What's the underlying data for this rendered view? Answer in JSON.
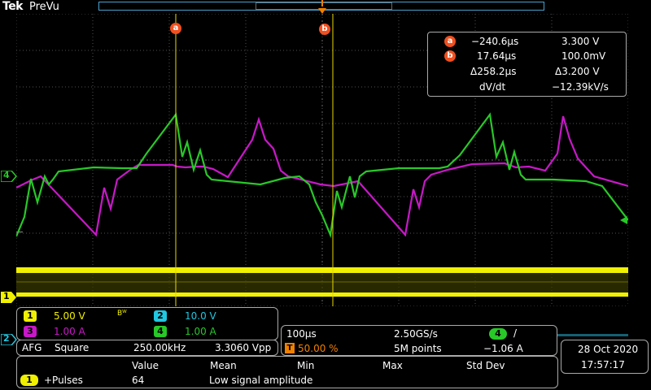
{
  "header": {
    "brand": "Tek",
    "mode": "PreVu"
  },
  "cursors": {
    "a": {
      "marker": "a",
      "time": "−240.6µs",
      "value": "3.300 V"
    },
    "b": {
      "marker": "b",
      "time": "17.64µs",
      "value": "100.0mV"
    },
    "delta": {
      "time": "Δ258.2µs",
      "value": "Δ3.200 V"
    },
    "slope": {
      "label": "dV/dt",
      "value": "−12.39kV/s"
    }
  },
  "channels": {
    "ch1": {
      "number": "1",
      "scale": "5.00 V",
      "bw": "Bᵂ",
      "color": "#f0f000"
    },
    "ch2": {
      "number": "2",
      "scale": "10.0 V",
      "color": "#20c8e0"
    },
    "ch3": {
      "number": "3",
      "scale": "1.00 A",
      "color": "#c818c8"
    },
    "ch4": {
      "number": "4",
      "scale": "1.00 A",
      "color": "#28c828"
    }
  },
  "waveforms": {
    "ch4_marker": "4",
    "ch1_marker": "1",
    "ch2_marker": "2"
  },
  "acquisition": {
    "timebase": "100µs",
    "sample_rate": "2.50GS/s",
    "trigger_channel": "4",
    "trigger_slope": "/",
    "trigger_flag": "T",
    "trigger_position": "50.00 %",
    "record_length": "5M points",
    "trigger_level": "−1.06 A"
  },
  "afg": {
    "label": "AFG",
    "waveform": "Square",
    "frequency": "250.00kHz",
    "amplitude": "3.3060 Vpp"
  },
  "measurements": {
    "headers": [
      "Value",
      "Mean",
      "Min",
      "Max",
      "Std Dev"
    ],
    "rows": [
      {
        "channel": "1",
        "name": "+Pulses",
        "value": "64",
        "status": "Low signal amplitude"
      }
    ]
  },
  "datetime": {
    "date": "28 Oct  2020",
    "time": "17:57:17"
  }
}
